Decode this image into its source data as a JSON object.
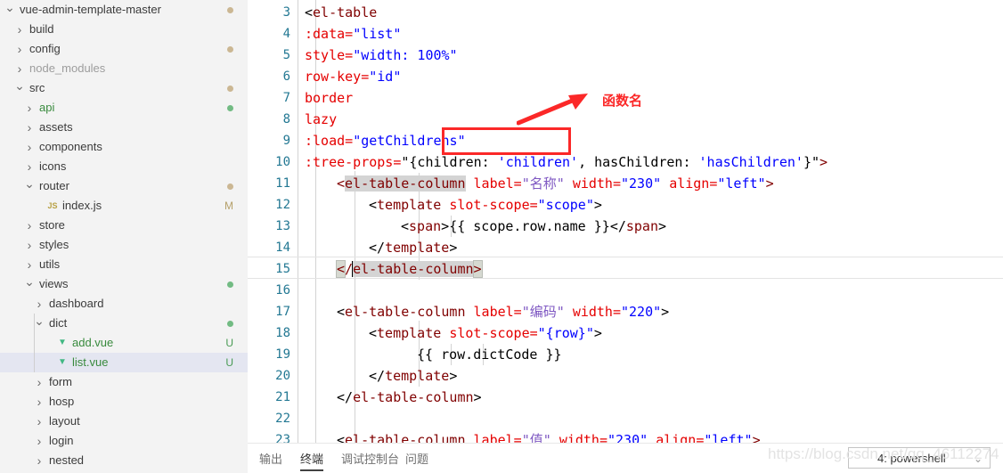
{
  "sidebar": {
    "items": [
      {
        "label": "vue-admin-template-master",
        "indent": 0,
        "twisty": "chevron-down",
        "icon": "none",
        "badge": "",
        "dot": "tan",
        "state": "normal",
        "selected": false
      },
      {
        "label": "build",
        "indent": 1,
        "twisty": "chevron-right",
        "icon": "none",
        "badge": "",
        "dot": "",
        "state": "normal",
        "selected": false
      },
      {
        "label": "config",
        "indent": 1,
        "twisty": "chevron-right",
        "icon": "none",
        "badge": "",
        "dot": "tan",
        "state": "normal",
        "selected": false
      },
      {
        "label": "node_modules",
        "indent": 1,
        "twisty": "chevron-right",
        "icon": "none",
        "badge": "",
        "dot": "",
        "state": "dim",
        "selected": false
      },
      {
        "label": "src",
        "indent": 1,
        "twisty": "chevron-down",
        "icon": "none",
        "badge": "",
        "dot": "tan",
        "state": "normal",
        "selected": false
      },
      {
        "label": "api",
        "indent": 2,
        "twisty": "chevron-right",
        "icon": "none",
        "badge": "",
        "dot": "green",
        "state": "green",
        "selected": false
      },
      {
        "label": "assets",
        "indent": 2,
        "twisty": "chevron-right",
        "icon": "none",
        "badge": "",
        "dot": "",
        "state": "normal",
        "selected": false
      },
      {
        "label": "components",
        "indent": 2,
        "twisty": "chevron-right",
        "icon": "none",
        "badge": "",
        "dot": "",
        "state": "normal",
        "selected": false
      },
      {
        "label": "icons",
        "indent": 2,
        "twisty": "chevron-right",
        "icon": "none",
        "badge": "",
        "dot": "",
        "state": "normal",
        "selected": false
      },
      {
        "label": "router",
        "indent": 2,
        "twisty": "chevron-down",
        "icon": "none",
        "badge": "",
        "dot": "tan",
        "state": "normal",
        "selected": false
      },
      {
        "label": "index.js",
        "indent": 3,
        "twisty": "none",
        "icon": "js",
        "badge": "M",
        "badge_kind": "mod",
        "dot": "",
        "state": "normal",
        "selected": false
      },
      {
        "label": "store",
        "indent": 2,
        "twisty": "chevron-right",
        "icon": "none",
        "badge": "",
        "dot": "",
        "state": "normal",
        "selected": false
      },
      {
        "label": "styles",
        "indent": 2,
        "twisty": "chevron-right",
        "icon": "none",
        "badge": "",
        "dot": "",
        "state": "normal",
        "selected": false
      },
      {
        "label": "utils",
        "indent": 2,
        "twisty": "chevron-right",
        "icon": "none",
        "badge": "",
        "dot": "",
        "state": "normal",
        "selected": false
      },
      {
        "label": "views",
        "indent": 2,
        "twisty": "chevron-down",
        "icon": "none",
        "badge": "",
        "dot": "green",
        "state": "normal",
        "selected": false
      },
      {
        "label": "dashboard",
        "indent": 3,
        "twisty": "chevron-right",
        "icon": "none",
        "badge": "",
        "dot": "",
        "state": "normal",
        "selected": false
      },
      {
        "label": "dict",
        "indent": 3,
        "twisty": "chevron-down",
        "icon": "none",
        "badge": "",
        "dot": "green",
        "state": "normal",
        "selected": false
      },
      {
        "label": "add.vue",
        "indent": 4,
        "twisty": "none",
        "icon": "vue",
        "badge": "U",
        "badge_kind": "untracked",
        "dot": "",
        "state": "green",
        "selected": false
      },
      {
        "label": "list.vue",
        "indent": 4,
        "twisty": "none",
        "icon": "vue",
        "badge": "U",
        "badge_kind": "untracked",
        "dot": "",
        "state": "green",
        "selected": true
      },
      {
        "label": "form",
        "indent": 3,
        "twisty": "chevron-right",
        "icon": "none",
        "badge": "",
        "dot": "",
        "state": "normal",
        "selected": false
      },
      {
        "label": "hosp",
        "indent": 3,
        "twisty": "chevron-right",
        "icon": "none",
        "badge": "",
        "dot": "",
        "state": "normal",
        "selected": false
      },
      {
        "label": "layout",
        "indent": 3,
        "twisty": "chevron-right",
        "icon": "none",
        "badge": "",
        "dot": "",
        "state": "normal",
        "selected": false
      },
      {
        "label": "login",
        "indent": 3,
        "twisty": "chevron-right",
        "icon": "none",
        "badge": "",
        "dot": "",
        "state": "normal",
        "selected": false
      },
      {
        "label": "nested",
        "indent": 3,
        "twisty": "chevron-right",
        "icon": "none",
        "badge": "",
        "dot": "",
        "state": "normal",
        "selected": false
      }
    ]
  },
  "editor": {
    "first_line_number": 3,
    "line_numbers": [
      3,
      4,
      5,
      6,
      7,
      8,
      9,
      10,
      11,
      12,
      13,
      14,
      15,
      16,
      17,
      18,
      19,
      20,
      21,
      22,
      23
    ],
    "current_line": 15,
    "lines": {
      "l3": "<el-table",
      "l4": ":data=\"list\"",
      "l5": "style=\"width: 100%\"",
      "l6": "row-key=\"id\"",
      "l7": "border",
      "l8": "lazy",
      "l9": ":load=\"getChildrens\"",
      "l10": ":tree-props=\"{children: 'children', hasChildren: 'hasChildren'}\">",
      "l11": "<el-table-column label=\"名称\" width=\"230\" align=\"left\">",
      "l12": "<template slot-scope=\"scope\">",
      "l13": "<span>{{ scope.row.name }}</span>",
      "l14": "</template>",
      "l15": "</el-table-column>",
      "l16": "",
      "l17": "<el-table-column label=\"编码\" width=\"220\">",
      "l18": "<template slot-scope=\"{row}\">",
      "l19": "{{ row.dictCode }}",
      "l20": "</template>",
      "l21": "</el-table-column>",
      "l22": "",
      "l23": "<el-table-column label=\"值\" width=\"230\" align=\"left\">"
    },
    "tokens": {
      "tag_open_lt": "<",
      "tag_close_gt": ">",
      "el_table": "el-table",
      "el_table_column": "el-table-column",
      "template": "template",
      "span": "span",
      "attr_data": ":data=",
      "attr_style": "style=",
      "attr_rowkey": "row-key=",
      "attr_border": "border",
      "attr_lazy": "lazy",
      "attr_load": ":load=",
      "attr_treeprops": ":tree-props=",
      "attr_label": "label=",
      "attr_width": "width=",
      "attr_align": "align=",
      "attr_slotscope": "slot-scope=",
      "v_list": "\"list\"",
      "v_width100": "\"width: 100%\"",
      "v_id": "\"id\"",
      "v_getchildrens_open": "\"",
      "v_getchildrens": "getChildrens",
      "v_getchildrens_close": "\"",
      "v_treeprops_head": "\"{children: ",
      "v_children": "'children'",
      "v_treeprops_mid": ", hasChildren: ",
      "v_haschildren": "'hasChildren'",
      "v_treeprops_tail": "}\"",
      "v_name_cn": "\"名称\"",
      "v_230": "\"230\"",
      "v_left": "\"left\"",
      "v_scope": "\"scope\"",
      "v_row": "\"{row}\"",
      "v_code_cn": "\"编码\"",
      "v_220": "\"220\"",
      "v_value_cn": "\"值\"",
      "mustache_name": "{{ scope.row.name }}",
      "mustache_dictcode": "{{ row.dictCode }}",
      "close_slash": "</",
      "close_slash_cursor": "</"
    }
  },
  "annotation": {
    "label": "函数名",
    "color": "#fb2828",
    "highlight_target": "\"getChildrens\""
  },
  "panel": {
    "tabs": [
      {
        "label": "输出",
        "active": false
      },
      {
        "label": "终端",
        "active": true
      },
      {
        "label": "调试控制台",
        "active": false
      },
      {
        "label": "问题",
        "active": false
      }
    ],
    "terminal_select": "4: powershell",
    "chevron": "⌄"
  },
  "watermark": "https://blog.csdn.net/qq_46112274"
}
